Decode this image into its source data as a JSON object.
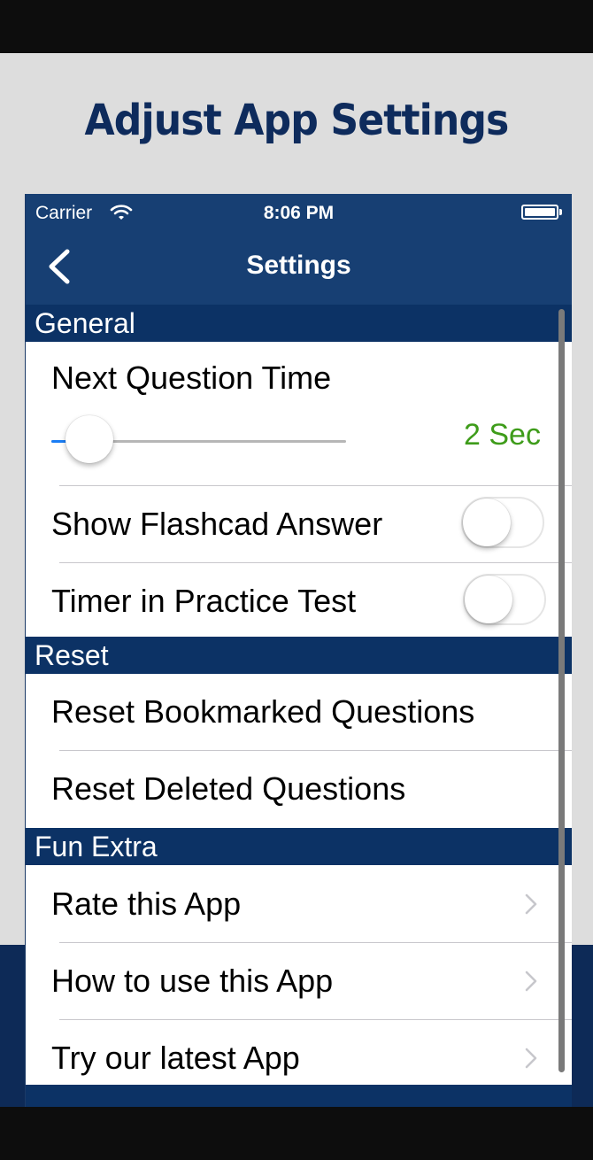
{
  "promo": {
    "title": "Adjust App Settings"
  },
  "status_bar": {
    "carrier": "Carrier",
    "time": "8:06 PM",
    "icons": [
      "wifi-icon",
      "battery-icon"
    ]
  },
  "nav": {
    "title": "Settings",
    "back_icon": "chevron-left-icon"
  },
  "sections": {
    "general": {
      "header": "General",
      "next_question_time": {
        "label": "Next Question Time",
        "value_label": "2 Sec",
        "slider_fraction": 0.13
      },
      "show_flashcard_answer": {
        "label": "Show Flashcad Answer",
        "on": false
      },
      "timer_practice_test": {
        "label": "Timer in Practice Test",
        "on": false
      }
    },
    "reset": {
      "header": "Reset",
      "bookmarked": "Reset Bookmarked Questions",
      "deleted": "Reset Deleted Questions"
    },
    "fun_extra": {
      "header": "Fun Extra",
      "rate": "Rate this App",
      "how_to": "How to use this App",
      "try_latest": "Try our latest App",
      "row_icon": "chevron-right-icon"
    }
  },
  "colors": {
    "nav_bar": "#173f73",
    "section_header": "#0c3265",
    "slider_active": "#1a7df5",
    "value_green": "#3e9c1a",
    "promo_title": "#0e2b5c"
  }
}
